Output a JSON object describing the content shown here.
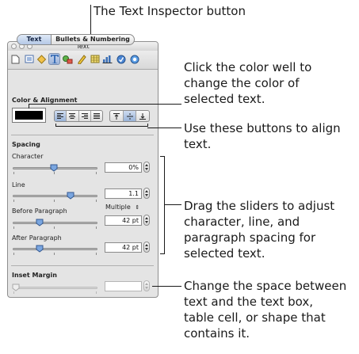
{
  "top_annotation": "The Text Inspector button",
  "window": {
    "title": "Text"
  },
  "toolbar": {
    "icons": [
      "document-icon",
      "layout-icon",
      "wrap-icon",
      "text-icon",
      "graphic-icon",
      "metrics-icon",
      "table-icon",
      "chart-icon",
      "link-icon",
      "quicktime-icon"
    ],
    "selected": "text-icon",
    "accent": "#3b6fb6"
  },
  "tabs": {
    "text": "Text",
    "bullets": "Bullets & Numbering",
    "selected": "Text"
  },
  "color_alignment": {
    "label": "Color & Alignment",
    "color_well": "#000000"
  },
  "spacing": {
    "label": "Spacing",
    "character": {
      "label": "Character",
      "value": "0%"
    },
    "line": {
      "label": "Line",
      "value": "1.1",
      "mode": "Multiple"
    },
    "before_paragraph": {
      "label": "Before Paragraph",
      "value": "42 pt"
    },
    "after_paragraph": {
      "label": "After Paragraph",
      "value": "42 pt"
    }
  },
  "inset_margin": {
    "label": "Inset Margin",
    "value": ""
  },
  "callouts": {
    "color_well": [
      "Click the color well to",
      "change the color of",
      "selected text."
    ],
    "align": [
      "Use these buttons to align",
      "text."
    ],
    "sliders": [
      "Drag the sliders to adjust",
      "character, line, and",
      "paragraph spacing for",
      "selected text."
    ],
    "inset": [
      "Change the space between",
      "text and the text box,",
      "table cell, or shape that",
      "contains it."
    ]
  }
}
